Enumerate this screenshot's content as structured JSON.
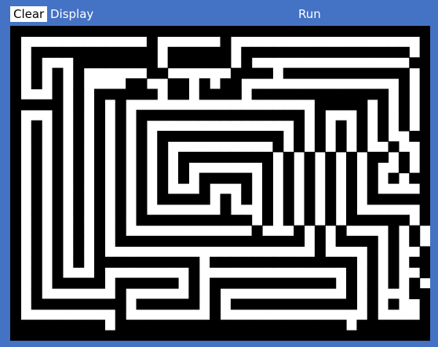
{
  "toolbar": {
    "clear_label": "Clear",
    "display_label": "Display",
    "run_label": "Run"
  },
  "colors": {
    "background": "#4472c4",
    "button_bg": "#ffffff",
    "button_text": "#000000",
    "toolbar_text": "#ffffff",
    "maze_wall": "#000000",
    "maze_path": "#ffffff"
  },
  "maze": {
    "cols": 40,
    "rows": 30,
    "wall_char": "#",
    "grid": [
      "########################################",
      "#            #      #                  #",
      "# ############ ###### ################ #",
      "# #   ######## ###### #               ##",
      "# # # #      ##      #### ############ #",
      "# # # #    ##  ## # ##               # #",
      "#   # # ###### ## #### ############# # #",
      "##### # # #                  ##### # # #",
      "#   # # # # ################ #   # # # #",
      "# # # # # # #              # # # # # # #",
      "# # # # # # # ############ # # # # #  ##",
      "# # # # # # # #          # # # # #  #  #",
      "# # # # # # # # ######### # # # # ## # #",
      "# # # # # # # # #       # # # # # #  # #",
      "# # # # # # # # # ##### # # # # # # # ##",
      "# # # # # # # #   #   # # # # # # #    #",
      "# # # # # # # ##### # # # # # # # ######",
      "# # # # # # #       #   # # # # #      #",
      "# # # # # # ########### # # # # ###### #",
      "# # # # # #            #   # # #    # #",
      "# # # # # ################## # #### # #",
      "# # # # #                    #    # #  #",
      "# # # # ########## ############## # # ##",
      "# # #   #        #              # # #  #",
      "# # ##### ###### # ############ # # # #",
      "# #       #      # #            # #   ##",
      "# ######### ###### # ############ # #  #",
      "#         #        #              #    #",
      "######### ###################### #######",
      "########################################"
    ]
  }
}
